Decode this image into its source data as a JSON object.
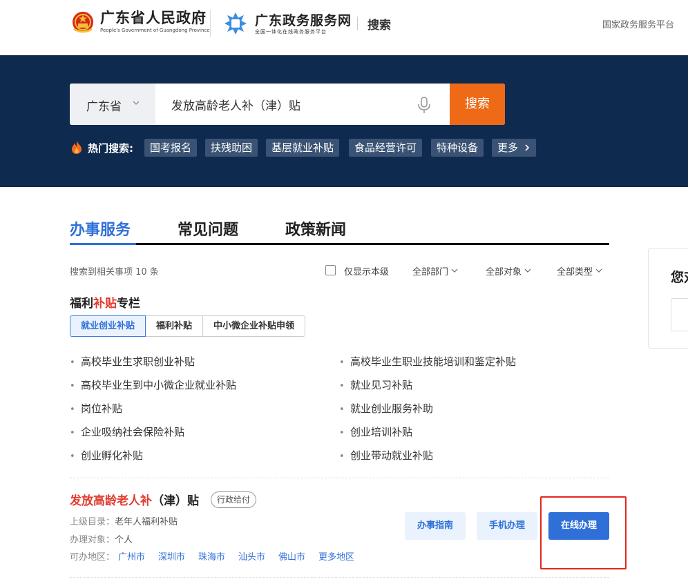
{
  "header": {
    "gov_title": "广东省人民政府",
    "gov_subtitle": "People's Government of Guangdong Province",
    "service_title": "广东政务服务网",
    "service_subtitle": "全国一体化在线政务服务平台",
    "search_label": "搜索",
    "national_link": "国家政务服务平台"
  },
  "search": {
    "region": "广东省",
    "query": "发放高龄老人补（津）贴",
    "button": "搜索"
  },
  "hot": {
    "label": "热门搜索:",
    "tags": [
      "国考报名",
      "扶残助困",
      "基层就业补贴",
      "食品经营许可",
      "特种设备",
      "更多"
    ]
  },
  "tabs": [
    "办事服务",
    "常见问题",
    "政策新闻"
  ],
  "filters": {
    "count_text": "搜索到相关事项 10 条",
    "only_this_level": "仅显示本级",
    "department": "全部部门",
    "target": "全部对象",
    "type": "全部类型"
  },
  "welfare": {
    "title_prefix": "福利",
    "title_highlight": "补贴",
    "title_suffix": "专栏",
    "subtabs": [
      "就业创业补贴",
      "福利补贴",
      "中小微企业补贴申领"
    ],
    "left_items": [
      "高校毕业生求职创业补贴",
      "高校毕业生到中小微企业就业补贴",
      "岗位补贴",
      "企业吸纳社会保险补贴",
      "创业孵化补贴"
    ],
    "right_items": [
      "高校毕业生职业技能培训和鉴定补贴",
      "就业见习补贴",
      "就业创业服务补助",
      "创业培训补贴",
      "创业带动就业补贴"
    ]
  },
  "result": {
    "title_highlight": "发放高龄老人补",
    "title_rest": "（津）贴",
    "badge": "行政给付",
    "parent_label": "上级目录：",
    "parent_value": "老年人福利补贴",
    "target_label": "办理对象：",
    "target_value": "个人",
    "regions_label": "可办地区：",
    "regions": [
      "广州市",
      "深圳市",
      "珠海市",
      "汕头市",
      "佛山市",
      "更多地区"
    ],
    "guide_button": "办事指南",
    "mobile_button": "手机办理",
    "online_button": "在线办理"
  },
  "side": {
    "title": "您对"
  },
  "colors": {
    "banner_bg": "#0f2a4f",
    "search_button": "#ee6a17",
    "accent_blue": "#2f6fd8",
    "highlight_red": "#e03b2f"
  }
}
